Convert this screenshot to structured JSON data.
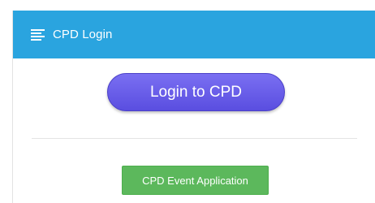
{
  "panel": {
    "title": "CPD Login",
    "header_color": "#2aa4df",
    "header_icon": "menu-lines-icon"
  },
  "login": {
    "button_label": "Login to CPD",
    "button_color": "#6a5fe8"
  },
  "event": {
    "button_label": "CPD Event Application",
    "button_color": "#5cb85c"
  }
}
